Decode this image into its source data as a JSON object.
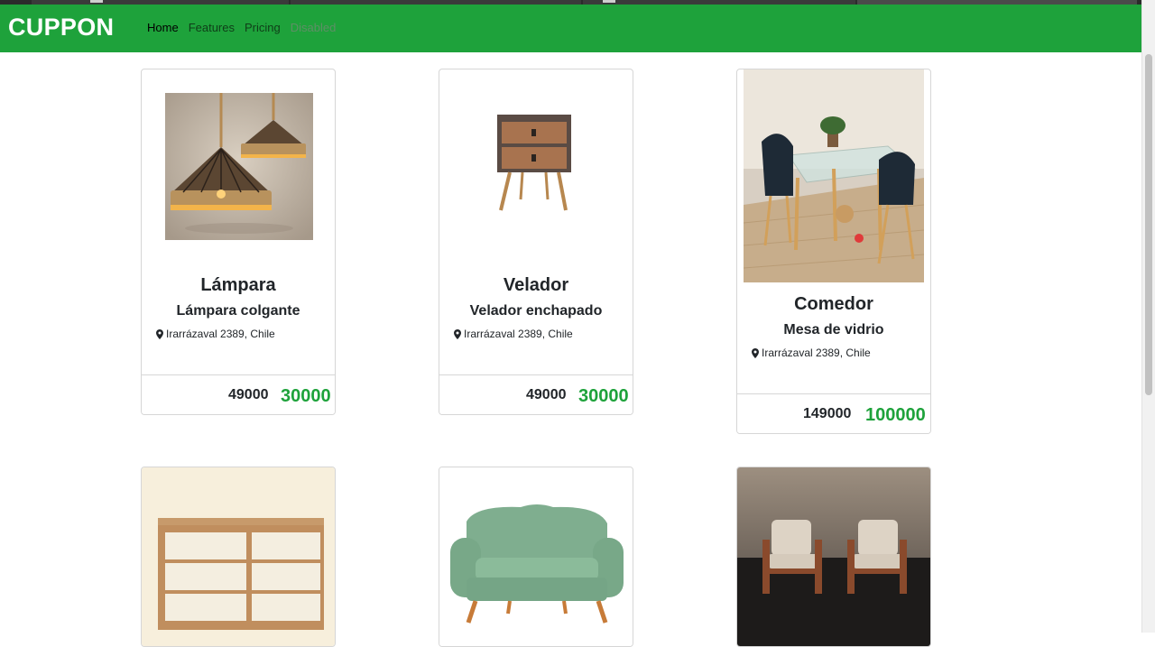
{
  "navbar": {
    "brand": "CUPPON",
    "links": [
      {
        "label": "Home",
        "state": "active"
      },
      {
        "label": "Features",
        "state": "normal"
      },
      {
        "label": "Pricing",
        "state": "normal"
      },
      {
        "label": "Disabled",
        "state": "disabled"
      }
    ],
    "bg_color": "#1ea23b"
  },
  "products": [
    {
      "title": "Lámpara",
      "subtitle": "Lámpara colgante",
      "location": "Irarrázaval 2389, Chile",
      "old_price": "49000",
      "new_price": "30000",
      "image": "hanging-rope-lamps"
    },
    {
      "title": "Velador",
      "subtitle": "Velador enchapado",
      "location": "Irarrázaval 2389, Chile",
      "old_price": "49000",
      "new_price": "30000",
      "image": "wooden-nightstand"
    },
    {
      "title": "Comedor",
      "subtitle": "Mesa de vidrio",
      "location": "Irarrázaval 2389, Chile",
      "old_price": "149000",
      "new_price": "100000",
      "image": "glass-dining-table"
    },
    {
      "image": "wooden-dresser"
    },
    {
      "image": "green-loveseat"
    },
    {
      "image": "two-armchairs"
    }
  ],
  "colors": {
    "price_new": "#1ea23b",
    "card_border": "#d6d6d6"
  }
}
